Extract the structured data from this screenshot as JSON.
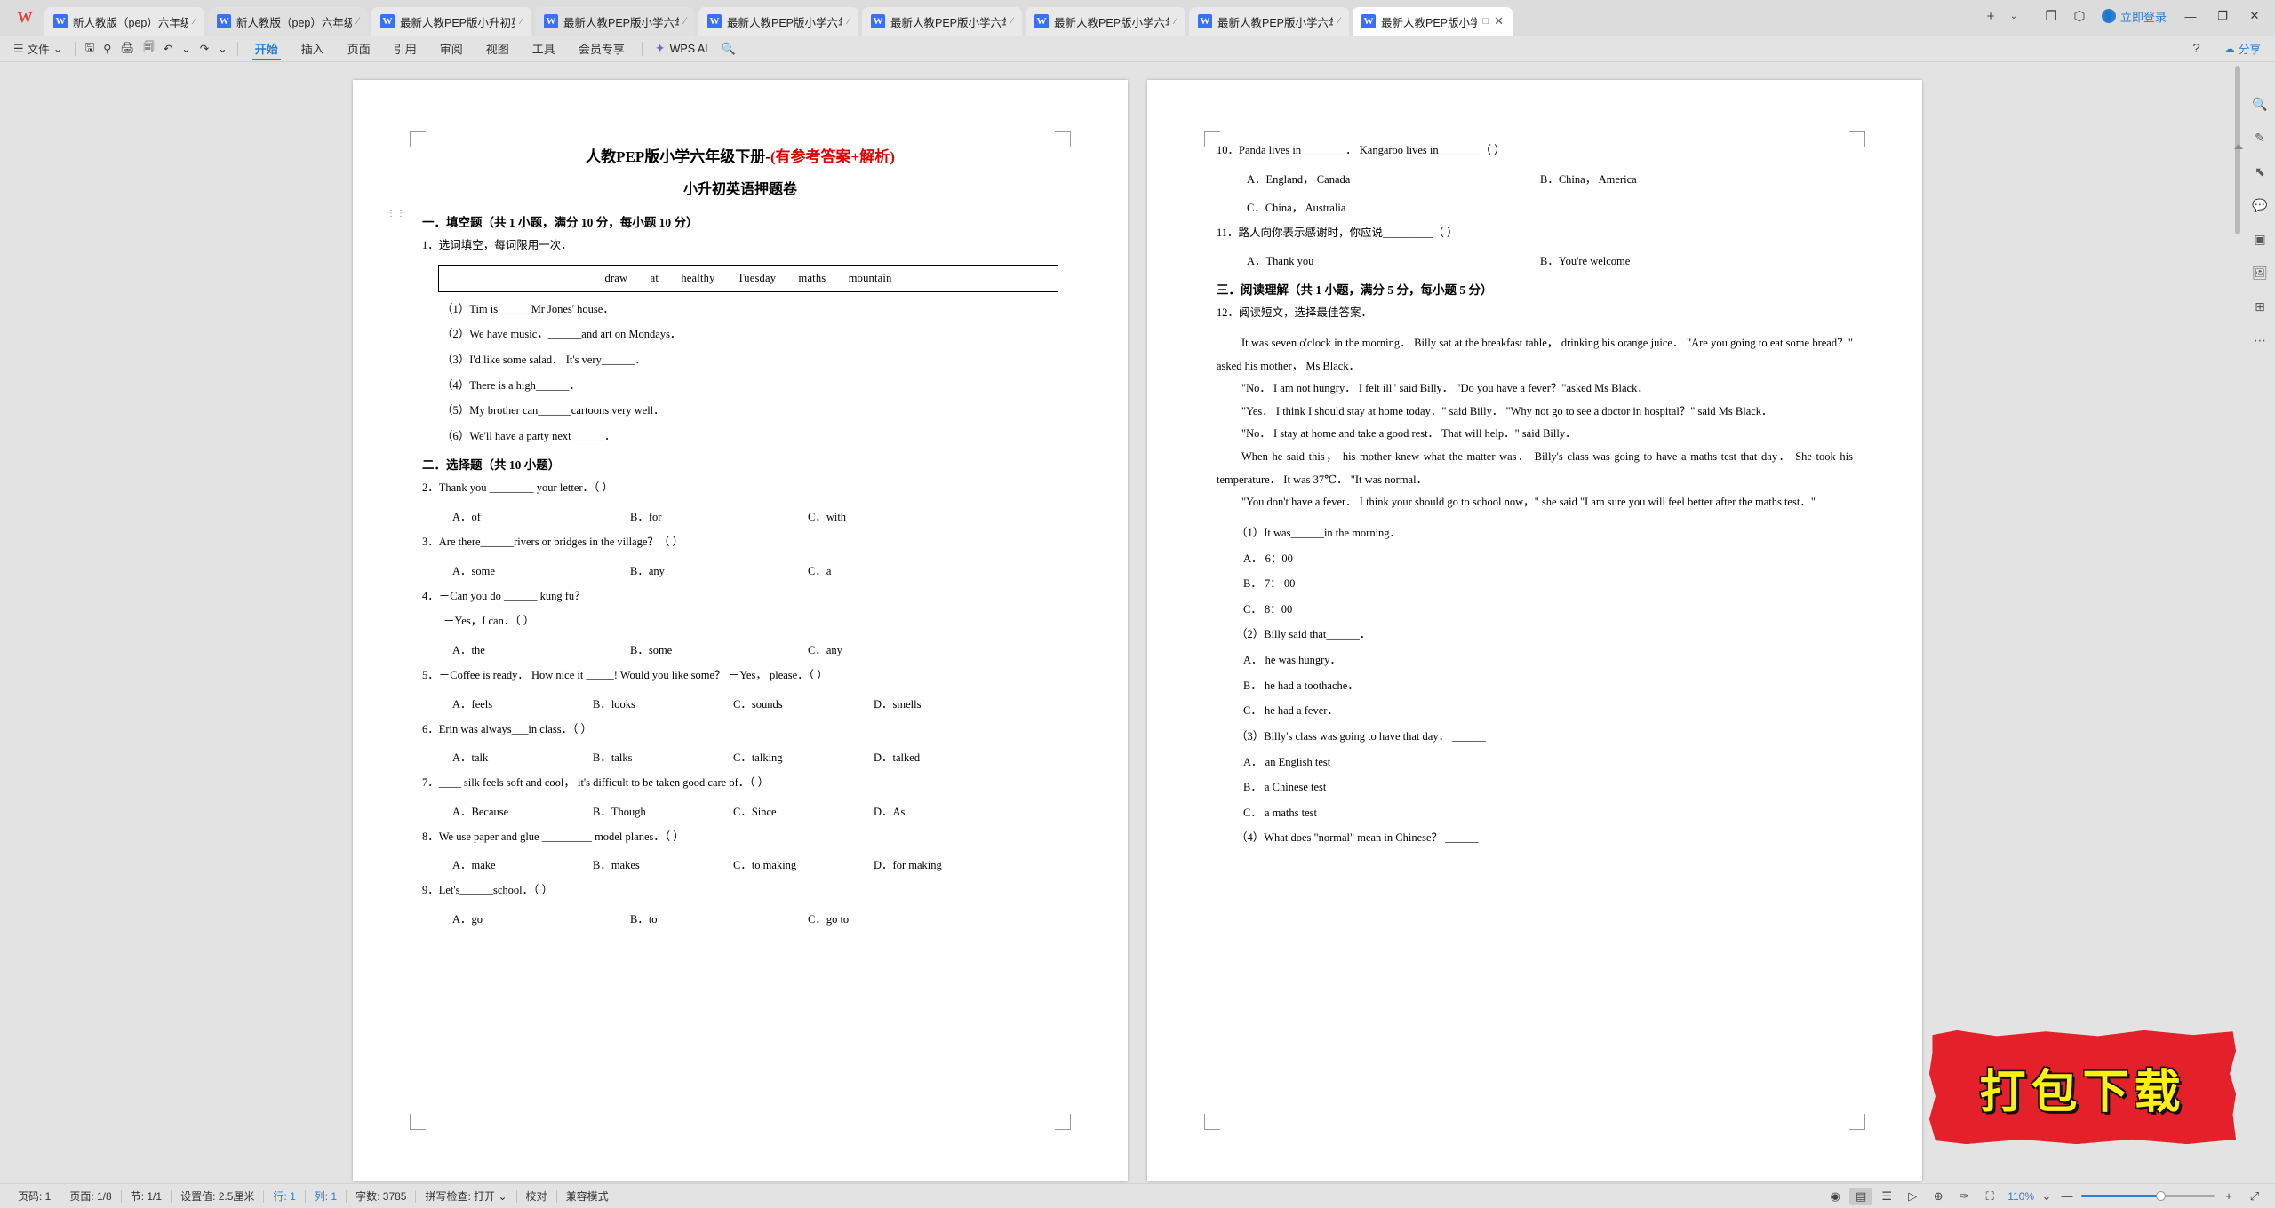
{
  "app": {
    "logo": "W",
    "account_label": "立即登录",
    "share_label": "分享"
  },
  "tabs": [
    {
      "icon": "W",
      "label": "新人教版（pep）六年级（下）",
      "state": "normal"
    },
    {
      "icon": "W",
      "label": "新人教版（pep）六年级（下）",
      "state": "dim"
    },
    {
      "icon": "W",
      "label": "最新人教PEP版小升初英语试卷",
      "state": "normal"
    },
    {
      "icon": "W",
      "label": "最新人教PEP版小学六年级下册",
      "state": "dim"
    },
    {
      "icon": "W",
      "label": "最新人教PEP版小学六年级下册",
      "state": "normal"
    },
    {
      "icon": "W",
      "label": "最新人教PEP版小学六年级下册",
      "state": "normal"
    },
    {
      "icon": "W",
      "label": "最新人教PEP版小学六年级下册",
      "state": "normal"
    },
    {
      "icon": "W",
      "label": "最新人教PEP版小学六年级下册",
      "state": "normal"
    },
    {
      "icon": "W",
      "label": "最新人教PEP版小学六年",
      "state": "active"
    }
  ],
  "tabbar_buttons": {
    "new_tab": "+",
    "new_tab_dropdown": "⌄",
    "tab_list": "❐",
    "globe": "⬡",
    "minimize": "—",
    "restore": "❐",
    "close": "✕"
  },
  "ribbon": {
    "file_menu": "文件",
    "file_menu_icon": "☰",
    "file_menu_caret": "⌄",
    "quick_icons": [
      {
        "name": "save-icon",
        "glyph": "🖫"
      },
      {
        "name": "save-as-icon",
        "glyph": "⚲"
      },
      {
        "name": "print-icon",
        "glyph": "🖨"
      },
      {
        "name": "print-preview-icon",
        "glyph": "🗐"
      },
      {
        "name": "undo-icon",
        "glyph": "↶"
      },
      {
        "name": "undo-dropdown-icon",
        "glyph": "⌄"
      },
      {
        "name": "redo-icon",
        "glyph": "↷"
      },
      {
        "name": "quick-access-dropdown-icon",
        "glyph": "⌄"
      }
    ],
    "tabs": [
      {
        "label": "开始",
        "active": true
      },
      {
        "label": "插入",
        "active": false
      },
      {
        "label": "页面",
        "active": false
      },
      {
        "label": "引用",
        "active": false
      },
      {
        "label": "审阅",
        "active": false
      },
      {
        "label": "视图",
        "active": false
      },
      {
        "label": "工具",
        "active": false
      },
      {
        "label": "会员专享",
        "active": false
      }
    ],
    "ai_label": "WPS AI",
    "search_icon": "🔍",
    "help_icon": "?"
  },
  "document": {
    "title_black": "人教PEP版小学六年级下册-",
    "title_red": "(有参考答案+解析)",
    "subtitle": "小升初英语押题卷",
    "section1_head": "一．填空题（共 1 小题，满分 10 分，每小题 10 分）",
    "q1_prompt": "1．选词填空，每词限用一次．",
    "wordbank": [
      "draw",
      "at",
      "healthy",
      "Tuesday",
      "maths",
      "mountain"
    ],
    "fill_items": [
      "（1）Tim is______Mr Jones' house．",
      "（2）We have music，______and art on Mondays．",
      "（3）I'd like some salad． It's very______．",
      "（4）There is a high______．",
      "（5）My brother can______cartoons very well．",
      "（6）We'll have a party next______．"
    ],
    "section2_head": "二．选择题（共 10 小题）",
    "choice_questions": [
      {
        "stem": "2．Thank you ________ your letter．（      ）",
        "options": [
          "A．of",
          "B．for",
          "C．with"
        ],
        "cols": 3
      },
      {
        "stem": "3．Are there______rivers or bridges in the village？（      ）",
        "options": [
          "A．some",
          "B．any",
          "C．a"
        ],
        "cols": 3
      },
      {
        "stem": "4．－Can you do ______ kung fu？",
        "stem2": "－Yes，I can．（      ）",
        "options": [
          "A．the",
          "B．some",
          "C．any"
        ],
        "cols": 3
      },
      {
        "stem": "5．－Coffee is ready． How nice it _____! Would you like some？ －Yes， please．（      ）",
        "options": [
          "A．feels",
          "B．looks",
          "C．sounds",
          "D．smells"
        ],
        "cols": 4
      },
      {
        "stem": "6．Erin was always___in class．（      ）",
        "options": [
          "A．talk",
          "B．talks",
          "C．talking",
          "D．talked"
        ],
        "cols": 4
      },
      {
        "stem": "7．____ silk feels soft and cool， it's difficult to be taken good care of．（      ）",
        "options": [
          "A．Because",
          "B．Though",
          "C．Since",
          "D．As"
        ],
        "cols": 4
      },
      {
        "stem": "8．We use paper and glue _________ model planes．（      ）",
        "options": [
          "A．make",
          "B．makes",
          "C．to making",
          "D．for making"
        ],
        "cols": 4
      },
      {
        "stem": "9．Let's______school．（      ）",
        "options": [
          "A．go",
          "B．to",
          "C．go to"
        ],
        "cols": 3
      }
    ],
    "page2_questions": [
      {
        "stem": "10．Panda lives in________． Kangaroo lives in  _______（      ）",
        "options": [
          "A．England， Canada",
          "B．China， America"
        ],
        "options2": [
          "C．China， Australia"
        ],
        "cols": 2
      },
      {
        "stem": "11．路人向你表示感谢时，你应说_________（      ）",
        "options": [
          "A．Thank you",
          "B．You're welcome"
        ],
        "cols": 2
      }
    ],
    "section3_head": "三．阅读理解（共 1 小题，满分 5 分，每小题 5 分）",
    "q12_prompt": "12．阅读短文，选择最佳答案．",
    "passage": [
      "It was seven o'clock in the morning． Billy sat at the breakfast table， drinking his orange juice． \"Are you going to eat some bread？\" asked his mother， Ms Black．",
      "\"No． I am not hungry． I felt ill\" said Billy． \"Do you have a fever？\"asked Ms Black．",
      "\"Yes． I think I should stay at home today．\" said Billy． \"Why not go to see a doctor in hospital？\" said Ms Black．",
      "\"No． I stay at home and take a good rest． That will help．\" said Billy．",
      "When he said this， his mother knew what the matter was． Billy's class was going to have a maths test that day． She took his temperature． It was 37℃． \"It was normal．",
      "\"You don't have a fever． I think your should go to school now，\" she said \"I am sure you will feel better after the maths test．\""
    ],
    "reading_questions": [
      {
        "stem": "（1）It was______in the morning．",
        "options": [
          "A． 6：00",
          "B． 7： 00",
          "C． 8：00"
        ]
      },
      {
        "stem": "（2）Billy said that______．",
        "options": [
          "A． he was hungry．",
          "B． he had a toothache．",
          "C． he had a fever．"
        ]
      },
      {
        "stem": "（3）Billy's class was going to have that day． ______",
        "options": [
          "A． an English test",
          "B． a Chinese test",
          "C． a maths test"
        ]
      },
      {
        "stem": "（4）What does \"normal\" mean in Chinese？ ______",
        "options": []
      }
    ]
  },
  "watermark": {
    "text": "打包下载",
    "bg_color": "#e4202a",
    "text_color": "#ffef15"
  },
  "sidetools": [
    {
      "name": "find-replace-icon",
      "glyph": "🔍"
    },
    {
      "name": "highlighter-icon",
      "glyph": "✎"
    },
    {
      "name": "select-icon",
      "glyph": "⬉"
    },
    {
      "name": "comment-icon",
      "glyph": "💬"
    },
    {
      "name": "shape-icon",
      "glyph": "▣"
    },
    {
      "name": "image-icon",
      "glyph": "🖼"
    },
    {
      "name": "table-icon",
      "glyph": "⊞"
    },
    {
      "name": "more-tools-icon",
      "glyph": "⋯"
    }
  ],
  "statusbar": {
    "left": [
      {
        "name": "page-number",
        "text": "页码: 1",
        "blue": false
      },
      {
        "name": "page-count",
        "text": "页面: 1/8",
        "blue": false
      },
      {
        "name": "section",
        "text": "节: 1/1",
        "blue": false
      },
      {
        "name": "margin-value",
        "text": "设置值: 2.5厘米",
        "blue": false
      },
      {
        "name": "row-indicator",
        "text": "行: 1",
        "blue": true
      },
      {
        "name": "column-indicator",
        "text": "列: 1",
        "blue": true
      },
      {
        "name": "word-count",
        "text": "字数: 3785",
        "blue": false
      },
      {
        "name": "spellcheck",
        "text": "拼写检查: 打开 ⌄",
        "blue": false
      },
      {
        "name": "proofread",
        "text": "校对",
        "blue": false
      },
      {
        "name": "compat-mode",
        "text": "兼容模式",
        "blue": false
      }
    ],
    "right_icons": [
      {
        "name": "eye-icon",
        "glyph": "◉",
        "selected": false
      },
      {
        "name": "page-layout-view-icon",
        "glyph": "▤",
        "selected": true
      },
      {
        "name": "outline-view-icon",
        "glyph": "☰",
        "selected": false
      },
      {
        "name": "reading-view-icon",
        "glyph": "▷",
        "selected": false
      },
      {
        "name": "web-view-icon",
        "glyph": "⊕",
        "selected": false
      },
      {
        "name": "ink-view-icon",
        "glyph": "✑",
        "selected": false
      },
      {
        "name": "focus-mode-icon",
        "glyph": "⛶",
        "selected": false
      }
    ],
    "zoom": "110%",
    "zoom_caret": "⌄",
    "zoom_out": "—",
    "zoom_in": "+",
    "fullscreen_icon": "⤢"
  }
}
